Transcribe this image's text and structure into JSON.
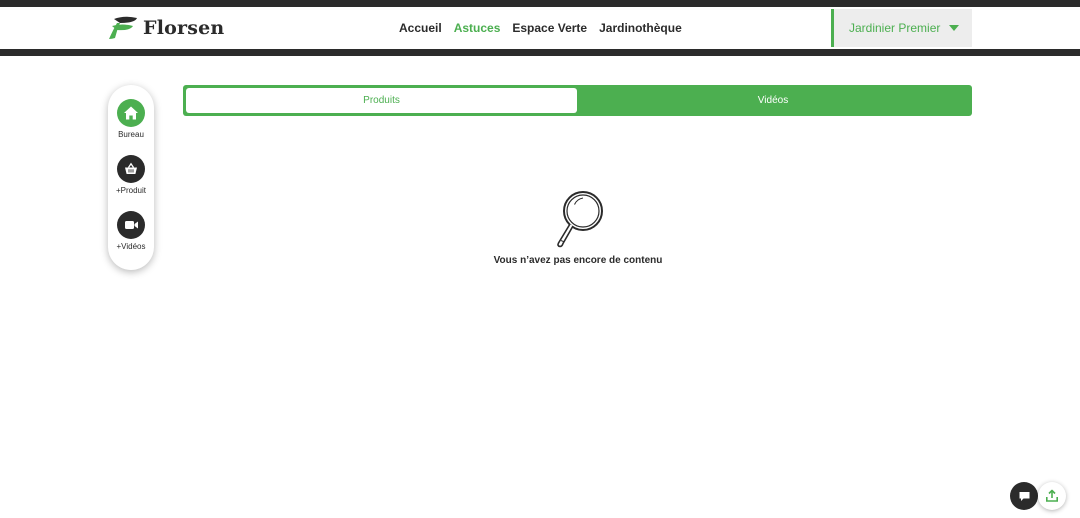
{
  "header": {
    "brand": "Florsen",
    "nav": [
      {
        "label": "Accueil",
        "active": false
      },
      {
        "label": "Astuces",
        "active": true
      },
      {
        "label": "Espace Verte",
        "active": false
      },
      {
        "label": "Jardinothèque",
        "active": false
      }
    ],
    "user": {
      "name": "Jardinier Premier",
      "icon": "caret-down-icon"
    }
  },
  "sidebar": {
    "items": [
      {
        "label": "Bureau",
        "icon": "home-icon",
        "color": "#4caf50"
      },
      {
        "label": "+Produit",
        "icon": "basket-icon",
        "color": "#2b2b2b"
      },
      {
        "label": "+Vidéos",
        "icon": "video-camera-icon",
        "color": "#2b2b2b"
      }
    ]
  },
  "tabs": [
    {
      "label": "Produits",
      "active": true
    },
    {
      "label": "Vidéos",
      "active": false
    }
  ],
  "empty_state": {
    "icon": "magnifier-icon",
    "message": "Vous n’avez pas encore de contenu"
  },
  "floating": {
    "chat_icon": "chat-icon",
    "upload_icon": "upload-icon"
  },
  "colors": {
    "accent": "#4caf50",
    "dark": "#2b2b2b",
    "user_menu_bg": "#ededed"
  }
}
